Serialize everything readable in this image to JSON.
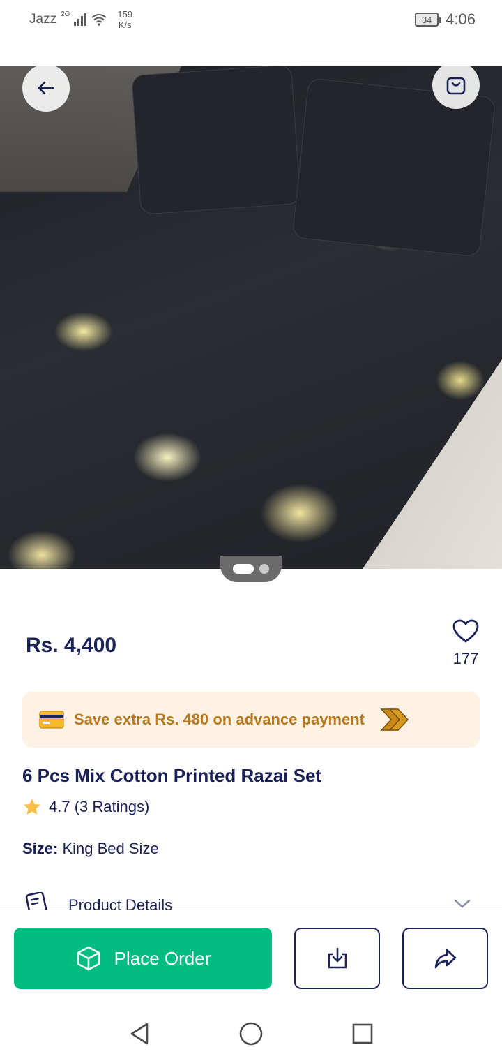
{
  "status_bar": {
    "carrier": "Jazz",
    "network": "2G",
    "speed_value": "159",
    "speed_unit": "K/s",
    "battery": "34",
    "time": "4:06"
  },
  "product": {
    "price": "Rs. 4,400",
    "wishlist_count": "177",
    "title": "6 Pcs Mix Cotton Printed Razai Set",
    "rating": "4.7 (3 Ratings)",
    "size_label": "Size:",
    "size_value": "King Bed Size",
    "image_count": 2,
    "current_image": 1
  },
  "promo": {
    "text": "Save extra Rs. 480 on advance payment"
  },
  "details": {
    "label": "Product Details"
  },
  "actions": {
    "place_order": "Place Order"
  },
  "icons": {
    "back": "arrow-left-icon",
    "cart": "shopping-bag-icon",
    "wishlist": "heart-icon",
    "promo": "credit-card-icon",
    "star": "star-icon",
    "order": "package-icon",
    "download": "download-icon",
    "share": "share-icon"
  },
  "colors": {
    "primary_text": "#1b2258",
    "accent_green": "#00bc80",
    "promo_bg": "#fdf2e4",
    "promo_text": "#b7791f",
    "star": "#f7c04a"
  }
}
